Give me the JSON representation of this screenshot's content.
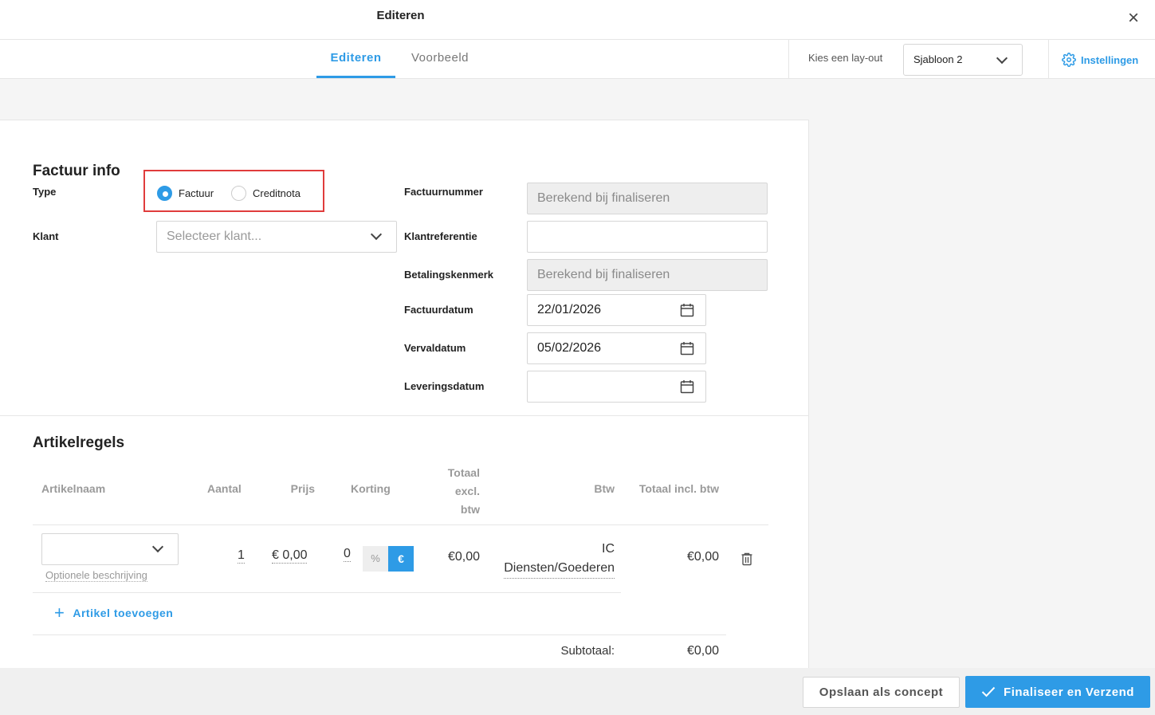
{
  "header": {
    "title": "Editeren",
    "close_icon": "×"
  },
  "tabs": [
    {
      "label": "Editeren",
      "active": true
    },
    {
      "label": "Voorbeeld",
      "active": false
    }
  ],
  "layout": {
    "label": "Kies een lay-out",
    "selected": "Sjabloon 2"
  },
  "settings": {
    "label": "Instellingen"
  },
  "invoice_info": {
    "title": "Factuur info",
    "type_label": "Type",
    "type_options": [
      {
        "label": "Factuur",
        "selected": true
      },
      {
        "label": "Creditnota",
        "selected": false
      }
    ],
    "client_label": "Klant",
    "client_placeholder": "Selecteer klant...",
    "fields": {
      "invoice_number": {
        "label": "Factuurnummer",
        "value": "Berekend bij finaliseren"
      },
      "client_reference": {
        "label": "Klantreferentie",
        "value": ""
      },
      "payment_reference": {
        "label": "Betalingskenmerk",
        "value": "Berekend bij finaliseren"
      },
      "invoice_date": {
        "label": "Factuurdatum",
        "value": "22/01/2026"
      },
      "due_date": {
        "label": "Vervaldatum",
        "value": "05/02/2026"
      },
      "delivery_date": {
        "label": "Leveringsdatum",
        "value": ""
      }
    }
  },
  "line_items": {
    "title": "Artikelregels",
    "columns": {
      "name": "Artikelnaam",
      "quantity": "Aantal",
      "price": "Prijs",
      "discount": "Korting",
      "total_excl_1": "Totaal",
      "total_excl_2": "excl.",
      "total_excl_3": "btw",
      "vat": "Btw",
      "total_incl": "Totaal incl. btw"
    },
    "rows": [
      {
        "name": "",
        "description_placeholder": "Optionele beschrijving",
        "quantity": "1",
        "price": "€ 0,00",
        "discount": "0",
        "discount_pct": "%",
        "discount_eur": "€",
        "total_excl": "€0,00",
        "vat_1": "IC",
        "vat_2": "Diensten/Goederen",
        "total_incl": "€0,00"
      }
    ],
    "add_label": "Artikel toevoegen",
    "subtotal_label": "Subtotaal:",
    "subtotal_value": "€0,00"
  },
  "footer": {
    "save_draft": "Opslaan als concept",
    "finalize": "Finaliseer en Verzend"
  },
  "colors": {
    "accent": "#2e9be6",
    "highlight": "#e03c3c"
  }
}
